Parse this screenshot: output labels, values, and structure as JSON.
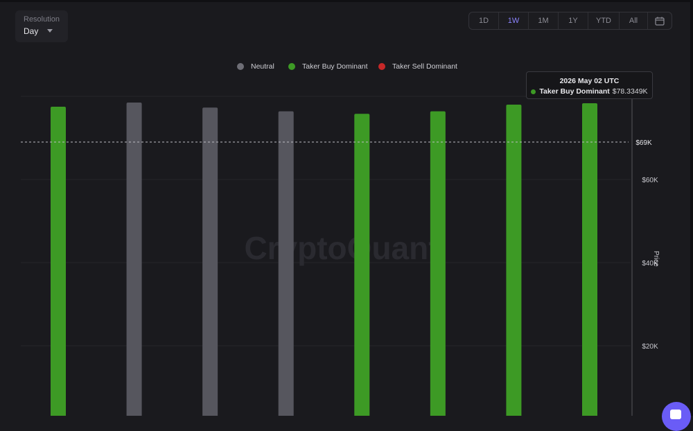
{
  "resolution": {
    "label": "Resolution",
    "value": "Day"
  },
  "range_buttons": [
    "1D",
    "1W",
    "1M",
    "1Y",
    "YTD",
    "All"
  ],
  "range_active": "1W",
  "legend": [
    {
      "label": "Neutral",
      "color": "#6e6e76"
    },
    {
      "label": "Taker Buy Dominant",
      "color": "#3d9a25"
    },
    {
      "label": "Taker Sell Dominant",
      "color": "#c62828"
    }
  ],
  "tooltip": {
    "date": "2026 May 02 UTC",
    "series": "Taker Buy Dominant",
    "value": "$78.3349K"
  },
  "watermark": "CryptoQuant",
  "crosshair_label": "$69K",
  "chart_data": {
    "type": "bar",
    "categories": [
      "",
      "",
      "",
      "",
      "",
      "",
      "",
      ""
    ],
    "values": [
      77.5,
      78.5,
      77.3,
      76.4,
      75.8,
      76.4,
      78.0,
      78.3349
    ],
    "colors": [
      "#3d9a25",
      "#56565e",
      "#56565e",
      "#56565e",
      "#3d9a25",
      "#3d9a25",
      "#3d9a25",
      "#3d9a25"
    ],
    "ylabel": "Price",
    "yticks": [
      "$20K",
      "$40K",
      "$60K"
    ],
    "ytick_values": [
      20,
      40,
      60
    ],
    "ylim": [
      0,
      100
    ],
    "crosshair_value": 69,
    "grid": true
  }
}
